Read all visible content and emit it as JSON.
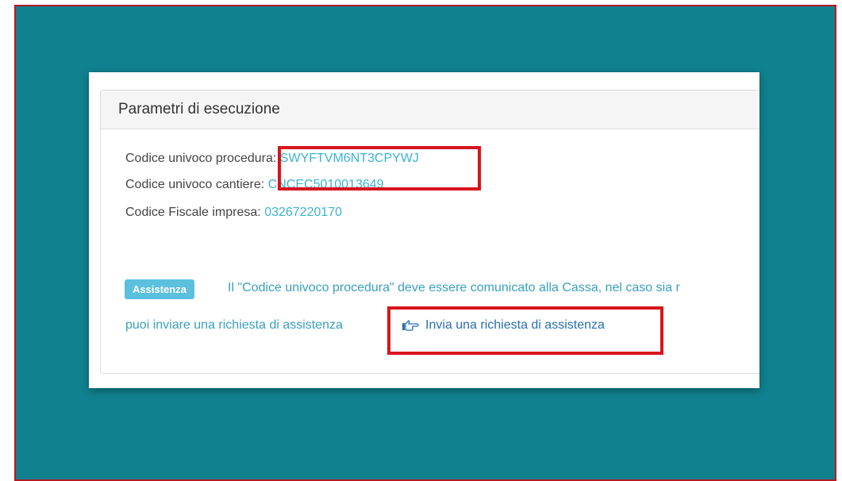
{
  "panel": {
    "title": "Parametri di esecuzione"
  },
  "params": [
    {
      "label": "Codice univoco procedura:",
      "value": "SWYFTVM6NT3CPYWJ"
    },
    {
      "label": "Codice univoco cantiere:",
      "value": "CNCEC5010013649"
    },
    {
      "label": "Codice Fiscale impresa:",
      "value": "03267220170"
    }
  ],
  "assistance": {
    "badge": "Assistenza",
    "message_line1": "Il \"Codice univoco procedura\" deve essere comunicato alla Cassa, nel caso sia r",
    "message_line2": "puoi inviare una richiesta di assistenza",
    "link_label": "Invia una richiesta di assistenza",
    "link_icon": "pointing-hand-icon"
  },
  "colors": {
    "background": "#10828f",
    "highlight": "#d8141c",
    "value_text": "#3bb4d2",
    "badge": "#5bc0de"
  }
}
